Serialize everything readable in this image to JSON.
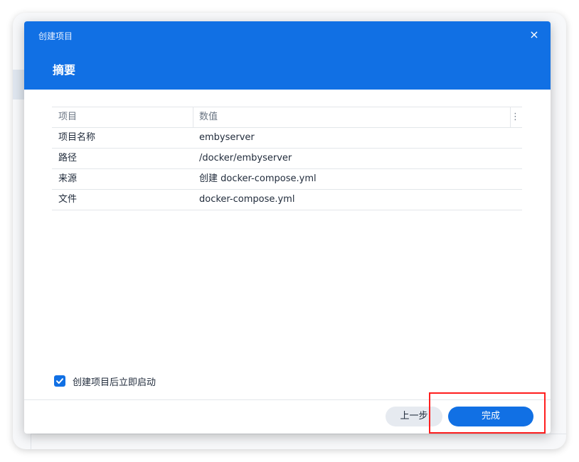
{
  "dialog": {
    "title": "创建项目",
    "step_title": "摘要",
    "close_icon": "×"
  },
  "table": {
    "columns": [
      "项目",
      "数值"
    ],
    "rows": [
      {
        "item": "项目名称",
        "value": "embyserver"
      },
      {
        "item": "路径",
        "value": "/docker/embyserver"
      },
      {
        "item": "来源",
        "value": "创建 docker-compose.yml"
      },
      {
        "item": "文件",
        "value": "docker-compose.yml"
      }
    ],
    "menu_icon": "⋮"
  },
  "options": {
    "start_after_create_label": "创建项目后立即启动",
    "start_after_create_checked": true
  },
  "footer": {
    "back_label": "上一步",
    "finish_label": "完成"
  },
  "colors": {
    "accent": "#1170e4",
    "highlight": "#ff1e1e"
  }
}
